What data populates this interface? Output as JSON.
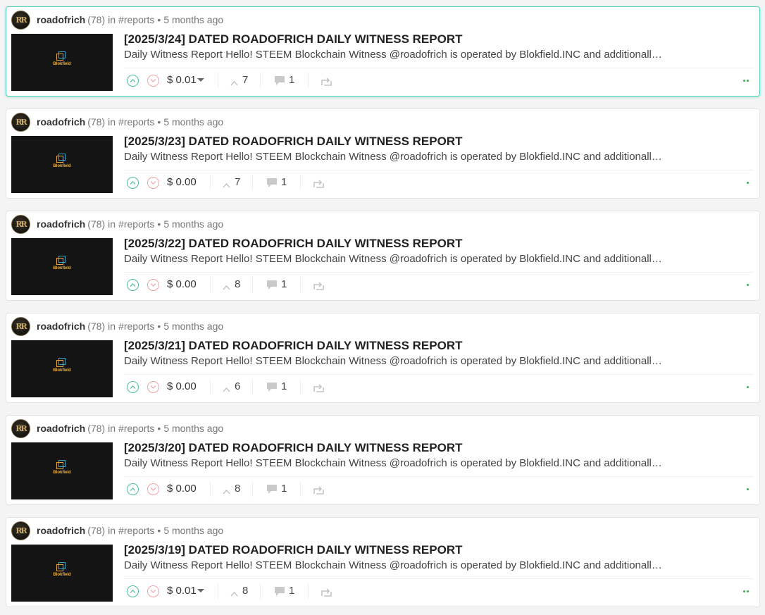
{
  "colors": {
    "accent_teal": "#4fd6bd",
    "upvote": "#4bbf9c",
    "downvote": "#f2a3a3",
    "dot_green": "#3fae57"
  },
  "posts": [
    {
      "author": "roadofrich",
      "reputation": "(78)",
      "in_word": "in",
      "tag": "#reports",
      "time": "5 months ago",
      "title": "[2025/3/24] DATED ROADOFRICH DAILY WITNESS REPORT",
      "excerpt": "Daily Witness Report Hello! STEEM Blockchain Witness @roadofrich is operated by Blokfield.INC and additionally…",
      "payout": "$ 0.01",
      "has_dropdown": true,
      "votes": "7",
      "comments": "1",
      "active": true,
      "dots": 2,
      "thumb_label": "Blokfield"
    },
    {
      "author": "roadofrich",
      "reputation": "(78)",
      "in_word": "in",
      "tag": "#reports",
      "time": "5 months ago",
      "title": "[2025/3/23] DATED ROADOFRICH DAILY WITNESS REPORT",
      "excerpt": "Daily Witness Report Hello! STEEM Blockchain Witness @roadofrich is operated by Blokfield.INC and additionally…",
      "payout": "$ 0.00",
      "has_dropdown": false,
      "votes": "7",
      "comments": "1",
      "active": false,
      "dots": 1,
      "thumb_label": "Blokfield"
    },
    {
      "author": "roadofrich",
      "reputation": "(78)",
      "in_word": "in",
      "tag": "#reports",
      "time": "5 months ago",
      "title": "[2025/3/22] DATED ROADOFRICH DAILY WITNESS REPORT",
      "excerpt": "Daily Witness Report Hello! STEEM Blockchain Witness @roadofrich is operated by Blokfield.INC and additionally…",
      "payout": "$ 0.00",
      "has_dropdown": false,
      "votes": "8",
      "comments": "1",
      "active": false,
      "dots": 1,
      "thumb_label": "Blokfield"
    },
    {
      "author": "roadofrich",
      "reputation": "(78)",
      "in_word": "in",
      "tag": "#reports",
      "time": "5 months ago",
      "title": "[2025/3/21] DATED ROADOFRICH DAILY WITNESS REPORT",
      "excerpt": "Daily Witness Report Hello! STEEM Blockchain Witness @roadofrich is operated by Blokfield.INC and additionally…",
      "payout": "$ 0.00",
      "has_dropdown": false,
      "votes": "6",
      "comments": "1",
      "active": false,
      "dots": 1,
      "thumb_label": "Blokfield"
    },
    {
      "author": "roadofrich",
      "reputation": "(78)",
      "in_word": "in",
      "tag": "#reports",
      "time": "5 months ago",
      "title": "[2025/3/20] DATED ROADOFRICH DAILY WITNESS REPORT",
      "excerpt": "Daily Witness Report Hello! STEEM Blockchain Witness @roadofrich is operated by Blokfield.INC and additionally…",
      "payout": "$ 0.00",
      "has_dropdown": false,
      "votes": "8",
      "comments": "1",
      "active": false,
      "dots": 1,
      "thumb_label": "Blokfield"
    },
    {
      "author": "roadofrich",
      "reputation": "(78)",
      "in_word": "in",
      "tag": "#reports",
      "time": "5 months ago",
      "title": "[2025/3/19] DATED ROADOFRICH DAILY WITNESS REPORT",
      "excerpt": "Daily Witness Report Hello! STEEM Blockchain Witness @roadofrich is operated by Blokfield.INC and additionally…",
      "payout": "$ 0.01",
      "has_dropdown": true,
      "votes": "8",
      "comments": "1",
      "active": false,
      "dots": 2,
      "thumb_label": "Blokfield"
    }
  ]
}
